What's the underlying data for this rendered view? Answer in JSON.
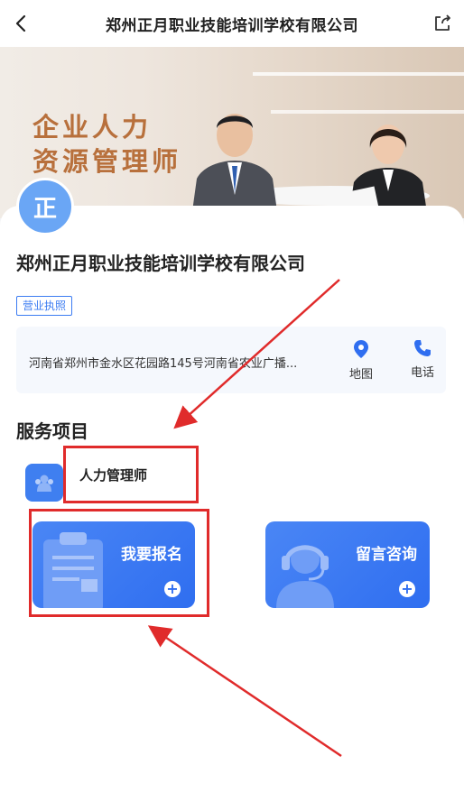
{
  "navbar": {
    "title": "郑州正月职业技能培训学校有限公司",
    "back_icon": "chevron-left-icon",
    "share_icon": "share-icon"
  },
  "banner": {
    "line1": "企业人力",
    "line2": "资源管理师"
  },
  "company": {
    "avatar_text": "正",
    "name": "郑州正月职业技能培训学校有限公司",
    "license_label": "营业执照",
    "address": "河南省郑州市金水区花园路145号河南省农业广播...",
    "map_label": "地图",
    "phone_label": "电话"
  },
  "services": {
    "section_title": "服务项目",
    "items": [
      {
        "label": "人力管理师"
      }
    ]
  },
  "actions": {
    "signup_label": "我要报名",
    "consult_label": "留言咨询"
  },
  "colors": {
    "accent": "#3c7cf2",
    "annotation": "#e02b2b"
  }
}
